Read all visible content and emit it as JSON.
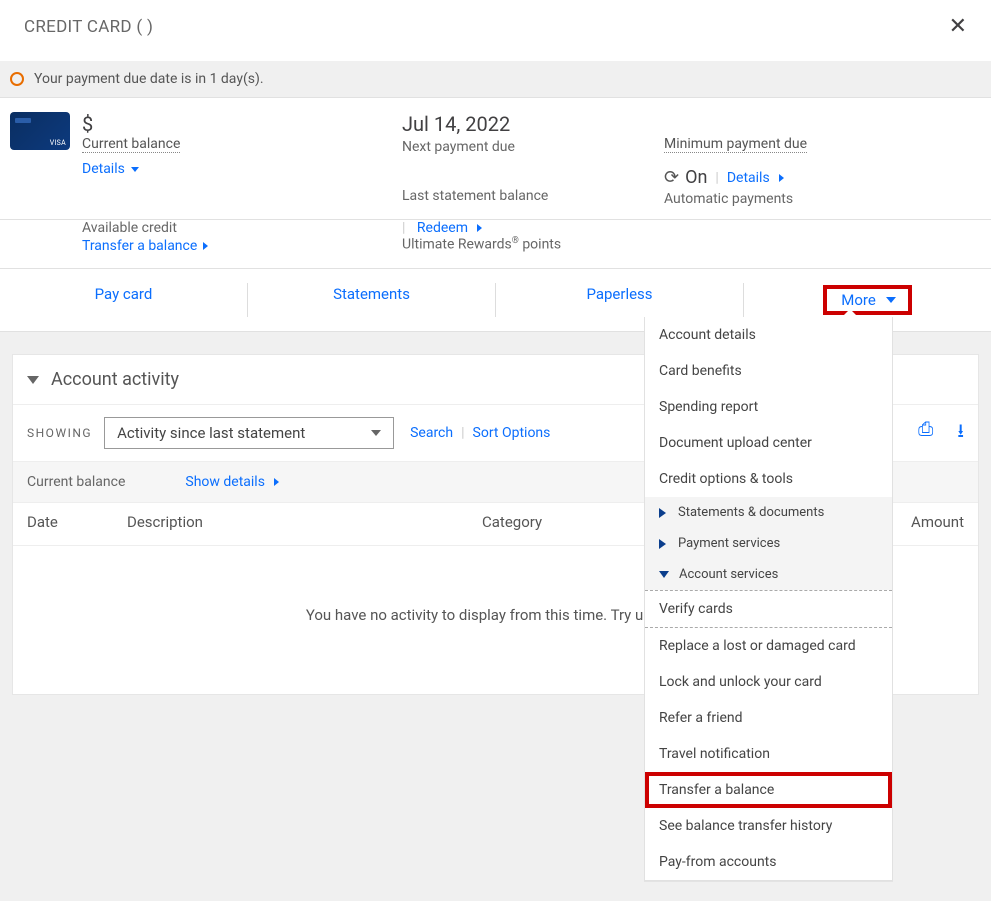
{
  "header": {
    "title": "CREDIT CARD (         )"
  },
  "notice": {
    "text": "Your payment due date is in 1 day(s)."
  },
  "overview": {
    "balance_symbol": "$",
    "balance_label": "Current balance",
    "details": "Details",
    "next_payment_date": "Jul 14, 2022",
    "next_payment_label": "Next payment due",
    "min_payment_label": "Minimum payment due",
    "last_statement_label": "Last statement balance",
    "autopay_status": "On",
    "autopay_details": "Details",
    "autopay_label": "Automatic payments",
    "available_credit_label": "Available credit",
    "transfer_balance": "Transfer a balance",
    "rewards_redeem": "Redeem",
    "rewards_label_a": "Ultimate Rewards",
    "rewards_label_b": " points"
  },
  "tabs": {
    "pay": "Pay card",
    "statements": "Statements",
    "paperless": "Paperless",
    "more": "More"
  },
  "more_menu": {
    "items_top": [
      "Account details",
      "Card benefits",
      "Spending report",
      "Document upload center",
      "Credit options & tools"
    ],
    "section_statements": "Statements & documents",
    "section_payment": "Payment services",
    "section_account": "Account services",
    "items_account": [
      "Verify cards",
      "Replace a lost or damaged card",
      "Lock and unlock your card",
      "Refer a friend",
      "Travel notification",
      "Transfer a balance",
      "See balance transfer history",
      "Pay-from accounts"
    ]
  },
  "activity": {
    "title": "Account activity",
    "showing_label": "SHOWING",
    "showing_value": "Activity since last statement",
    "search": "Search",
    "sort": "Sort Options",
    "curbal_label": "Current balance",
    "show_details": "Show details",
    "cols": {
      "date": "Date",
      "desc": "Description",
      "cat": "Category",
      "amt": "Amount"
    },
    "empty": "You have no activity to display from this time. Try updatin"
  }
}
